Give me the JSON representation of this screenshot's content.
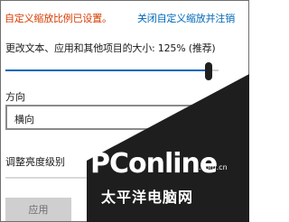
{
  "display_settings": {
    "custom_scaling_warning": "自定义缩放比例已设置。",
    "disable_custom_scaling_link": "关闭自定义缩放并注销",
    "scale_label": "更改文本、应用和其他项目的大小: 125% (推荐)",
    "scale_slider_fraction": 0.955,
    "orientation_label": "方向",
    "orientation_value": "横向",
    "brightness_label": "调整亮度级别",
    "apply_button": "应用"
  },
  "watermark": {
    "brand": "PConline",
    "domain": ".com.cn",
    "chinese": "太平洋电脑网"
  },
  "colors": {
    "warning": "#d83b01",
    "link": "#0067b8",
    "slider_thumb": "#1f1f1f",
    "watermark_bg": "#1e1e1e"
  },
  "icons": {
    "dropdown": "chevron-down-icon"
  }
}
